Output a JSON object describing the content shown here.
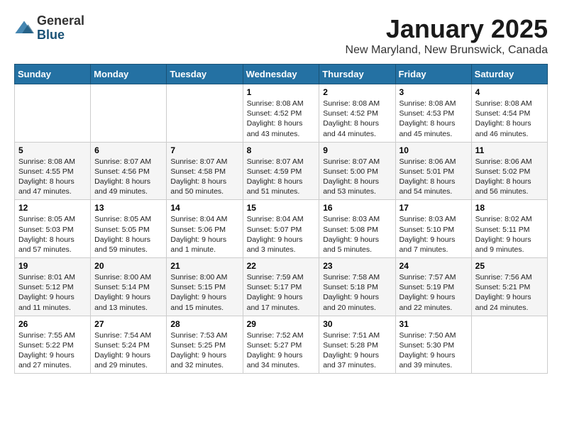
{
  "logo": {
    "general": "General",
    "blue": "Blue"
  },
  "title": "January 2025",
  "subtitle": "New Maryland, New Brunswick, Canada",
  "headers": [
    "Sunday",
    "Monday",
    "Tuesday",
    "Wednesday",
    "Thursday",
    "Friday",
    "Saturday"
  ],
  "weeks": [
    [
      {
        "day": "",
        "detail": ""
      },
      {
        "day": "",
        "detail": ""
      },
      {
        "day": "",
        "detail": ""
      },
      {
        "day": "1",
        "detail": "Sunrise: 8:08 AM\nSunset: 4:52 PM\nDaylight: 8 hours\nand 43 minutes."
      },
      {
        "day": "2",
        "detail": "Sunrise: 8:08 AM\nSunset: 4:52 PM\nDaylight: 8 hours\nand 44 minutes."
      },
      {
        "day": "3",
        "detail": "Sunrise: 8:08 AM\nSunset: 4:53 PM\nDaylight: 8 hours\nand 45 minutes."
      },
      {
        "day": "4",
        "detail": "Sunrise: 8:08 AM\nSunset: 4:54 PM\nDaylight: 8 hours\nand 46 minutes."
      }
    ],
    [
      {
        "day": "5",
        "detail": "Sunrise: 8:08 AM\nSunset: 4:55 PM\nDaylight: 8 hours\nand 47 minutes."
      },
      {
        "day": "6",
        "detail": "Sunrise: 8:07 AM\nSunset: 4:56 PM\nDaylight: 8 hours\nand 49 minutes."
      },
      {
        "day": "7",
        "detail": "Sunrise: 8:07 AM\nSunset: 4:58 PM\nDaylight: 8 hours\nand 50 minutes."
      },
      {
        "day": "8",
        "detail": "Sunrise: 8:07 AM\nSunset: 4:59 PM\nDaylight: 8 hours\nand 51 minutes."
      },
      {
        "day": "9",
        "detail": "Sunrise: 8:07 AM\nSunset: 5:00 PM\nDaylight: 8 hours\nand 53 minutes."
      },
      {
        "day": "10",
        "detail": "Sunrise: 8:06 AM\nSunset: 5:01 PM\nDaylight: 8 hours\nand 54 minutes."
      },
      {
        "day": "11",
        "detail": "Sunrise: 8:06 AM\nSunset: 5:02 PM\nDaylight: 8 hours\nand 56 minutes."
      }
    ],
    [
      {
        "day": "12",
        "detail": "Sunrise: 8:05 AM\nSunset: 5:03 PM\nDaylight: 8 hours\nand 57 minutes."
      },
      {
        "day": "13",
        "detail": "Sunrise: 8:05 AM\nSunset: 5:05 PM\nDaylight: 8 hours\nand 59 minutes."
      },
      {
        "day": "14",
        "detail": "Sunrise: 8:04 AM\nSunset: 5:06 PM\nDaylight: 9 hours\nand 1 minute."
      },
      {
        "day": "15",
        "detail": "Sunrise: 8:04 AM\nSunset: 5:07 PM\nDaylight: 9 hours\nand 3 minutes."
      },
      {
        "day": "16",
        "detail": "Sunrise: 8:03 AM\nSunset: 5:08 PM\nDaylight: 9 hours\nand 5 minutes."
      },
      {
        "day": "17",
        "detail": "Sunrise: 8:03 AM\nSunset: 5:10 PM\nDaylight: 9 hours\nand 7 minutes."
      },
      {
        "day": "18",
        "detail": "Sunrise: 8:02 AM\nSunset: 5:11 PM\nDaylight: 9 hours\nand 9 minutes."
      }
    ],
    [
      {
        "day": "19",
        "detail": "Sunrise: 8:01 AM\nSunset: 5:12 PM\nDaylight: 9 hours\nand 11 minutes."
      },
      {
        "day": "20",
        "detail": "Sunrise: 8:00 AM\nSunset: 5:14 PM\nDaylight: 9 hours\nand 13 minutes."
      },
      {
        "day": "21",
        "detail": "Sunrise: 8:00 AM\nSunset: 5:15 PM\nDaylight: 9 hours\nand 15 minutes."
      },
      {
        "day": "22",
        "detail": "Sunrise: 7:59 AM\nSunset: 5:17 PM\nDaylight: 9 hours\nand 17 minutes."
      },
      {
        "day": "23",
        "detail": "Sunrise: 7:58 AM\nSunset: 5:18 PM\nDaylight: 9 hours\nand 20 minutes."
      },
      {
        "day": "24",
        "detail": "Sunrise: 7:57 AM\nSunset: 5:19 PM\nDaylight: 9 hours\nand 22 minutes."
      },
      {
        "day": "25",
        "detail": "Sunrise: 7:56 AM\nSunset: 5:21 PM\nDaylight: 9 hours\nand 24 minutes."
      }
    ],
    [
      {
        "day": "26",
        "detail": "Sunrise: 7:55 AM\nSunset: 5:22 PM\nDaylight: 9 hours\nand 27 minutes."
      },
      {
        "day": "27",
        "detail": "Sunrise: 7:54 AM\nSunset: 5:24 PM\nDaylight: 9 hours\nand 29 minutes."
      },
      {
        "day": "28",
        "detail": "Sunrise: 7:53 AM\nSunset: 5:25 PM\nDaylight: 9 hours\nand 32 minutes."
      },
      {
        "day": "29",
        "detail": "Sunrise: 7:52 AM\nSunset: 5:27 PM\nDaylight: 9 hours\nand 34 minutes."
      },
      {
        "day": "30",
        "detail": "Sunrise: 7:51 AM\nSunset: 5:28 PM\nDaylight: 9 hours\nand 37 minutes."
      },
      {
        "day": "31",
        "detail": "Sunrise: 7:50 AM\nSunset: 5:30 PM\nDaylight: 9 hours\nand 39 minutes."
      },
      {
        "day": "",
        "detail": ""
      }
    ]
  ]
}
